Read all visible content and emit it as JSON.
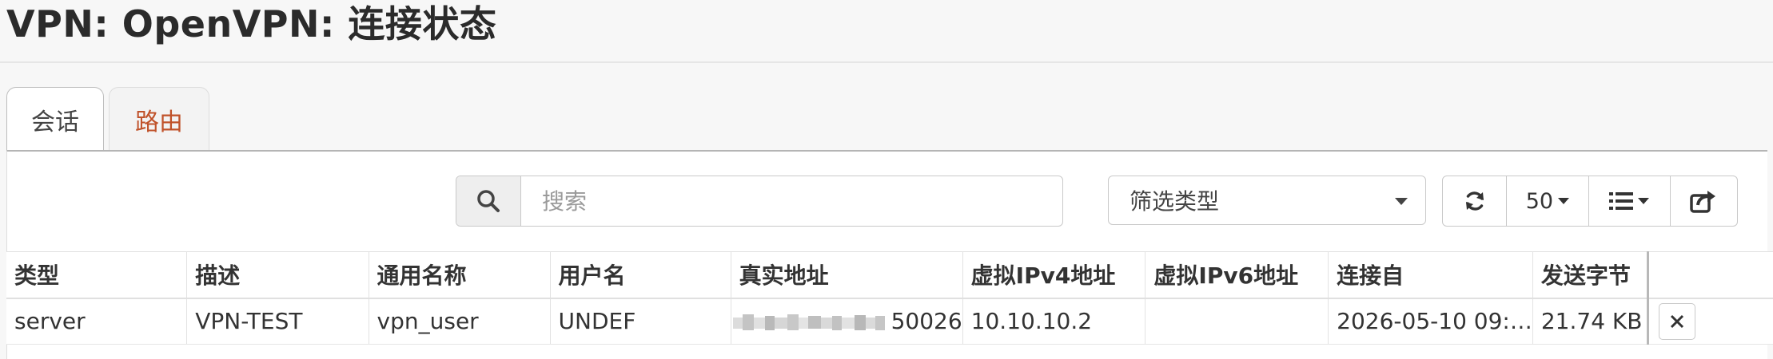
{
  "page": {
    "title": "VPN: OpenVPN: 连接状态"
  },
  "tabs": [
    {
      "label": "会话",
      "active": true
    },
    {
      "label": "路由",
      "active": false
    }
  ],
  "search": {
    "placeholder": "搜索",
    "value": ""
  },
  "filter": {
    "label": "筛选类型"
  },
  "toolbar": {
    "page_size": "50"
  },
  "table": {
    "columns": [
      "类型",
      "描述",
      "通用名称",
      "用户名",
      "真实地址",
      "虚拟IPv4地址",
      "虚拟IPv6地址",
      "连接自",
      "发送字节"
    ],
    "rows": [
      {
        "type": "server",
        "description": "VPN-TEST",
        "common_name": "vpn_user",
        "username": "UNDEF",
        "real_address_port": "50026",
        "virtual_ipv4": "10.10.10.2",
        "virtual_ipv6": "",
        "connected_since": "2026-05-10 09:…",
        "bytes_sent": "21.74 KB"
      }
    ]
  },
  "colors": {
    "tab_inactive_text": "#c0522a",
    "border": "#c9c9c9"
  }
}
